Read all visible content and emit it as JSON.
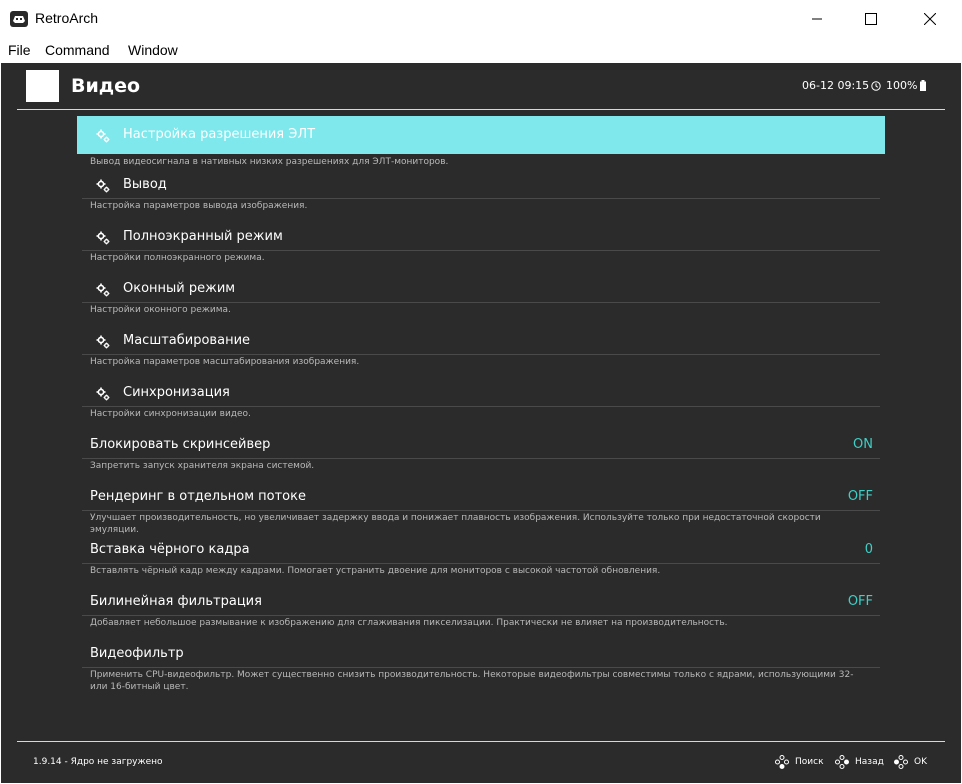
{
  "window": {
    "title": "RetroArch",
    "menu": [
      "File",
      "Command",
      "Window"
    ]
  },
  "header": {
    "title": "Видео",
    "clock": "06-12 09:15",
    "battery": "100%"
  },
  "entries": [
    {
      "label": "Настройка разрешения ЭЛТ",
      "desc": "Вывод видеосигнала в нативных низких разрешениях для ЭЛТ-мониторов.",
      "icon": "gear-icon",
      "selected": true
    },
    {
      "label": "Вывод",
      "desc": "Настройка параметров вывода изображения.",
      "icon": "gear-icon"
    },
    {
      "label": "Полноэкранный режим",
      "desc": "Настройки полноэкранного режима.",
      "icon": "gear-icon"
    },
    {
      "label": "Оконный режим",
      "desc": "Настройки оконного режима.",
      "icon": "gear-icon"
    },
    {
      "label": "Масштабирование",
      "desc": "Настройка параметров масштабирования изображения.",
      "icon": "gear-icon"
    },
    {
      "label": "Синхронизация",
      "desc": "Настройки синхронизации видео.",
      "icon": "gear-icon"
    },
    {
      "label": "Блокировать скринсейвер",
      "value": "ON",
      "desc": "Запретить запуск хранителя экрана системой."
    },
    {
      "label": "Рендеринг в отдельном потоке",
      "value": "OFF",
      "desc": "Улучшает производительность, но увеличивает задержку ввода и понижает плавность изображения. Используйте только при недостаточной скорости эмуляции."
    },
    {
      "label": "Вставка чёрного кадра",
      "value": "0",
      "desc": "Вставлять чёрный кадр между кадрами. Помогает устранить двоение для мониторов с высокой частотой обновления."
    },
    {
      "label": "Билинейная фильтрация",
      "value": "OFF",
      "desc": "Добавляет небольшое размывание к изображению для сглаживания пикселизации. Практически не влияет на производительность."
    },
    {
      "label": "Видеофильтр",
      "desc": "Применить CPU-видеофильтр. Может существенно снизить производительность. Некоторые видеофильтры совместимы только с ядрами, использующими 32- или 16-битный цвет."
    }
  ],
  "footer": {
    "version": "1.9.14 - Ядро не загружено",
    "search": "Поиск",
    "back": "Назад",
    "ok": "OK"
  },
  "colors": {
    "background": "#2b2b2b",
    "selection": "#7fe8ec",
    "value": "#3ecfc6",
    "description": "#b9b9b9"
  }
}
